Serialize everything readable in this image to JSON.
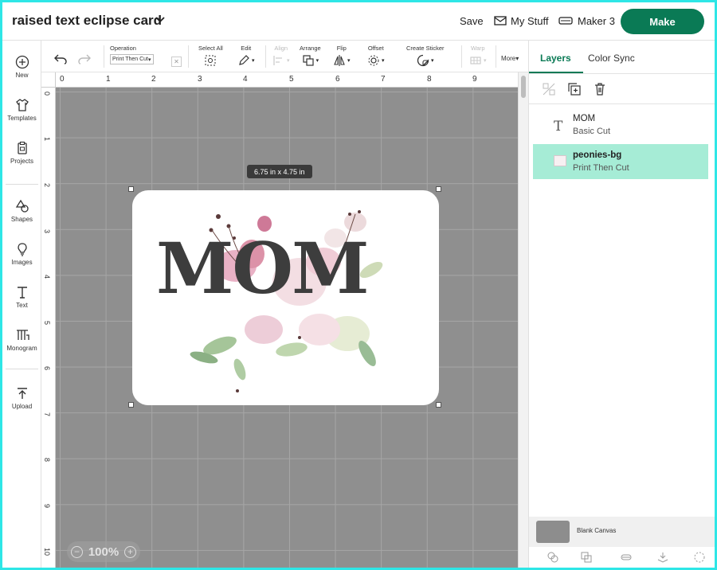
{
  "app": {
    "project_title": "raised text eclipse card",
    "save_label": "Save",
    "mystuff_label": "My Stuff",
    "machine_label": "Maker 3",
    "make_label": "Make",
    "accent_color": "#0a7a55",
    "frame_color": "#2ee6e6"
  },
  "sidebar": {
    "items": [
      {
        "label": "New",
        "icon": "plus-circle-icon"
      },
      {
        "label": "Templates",
        "icon": "shirt-icon"
      },
      {
        "label": "Projects",
        "icon": "clipboard-icon"
      },
      {
        "label": "Shapes",
        "icon": "shapes-icon"
      },
      {
        "label": "Images",
        "icon": "lightbulb-icon"
      },
      {
        "label": "Text",
        "icon": "text-icon"
      },
      {
        "label": "Monogram",
        "icon": "monogram-icon"
      },
      {
        "label": "Upload",
        "icon": "upload-icon"
      }
    ]
  },
  "toolbar": {
    "operation_label": "Operation",
    "operation_value": "Print Then Cut",
    "select_all_label": "Select All",
    "edit_label": "Edit",
    "align_label": "Align",
    "arrange_label": "Arrange",
    "flip_label": "Flip",
    "offset_label": "Offset",
    "create_sticker_label": "Create Sticker",
    "warp_label": "Warp",
    "more_label": "More"
  },
  "rulers": {
    "top": [
      "0",
      "1",
      "2",
      "3",
      "4",
      "5",
      "6",
      "7",
      "8",
      "9"
    ],
    "left": [
      "0",
      "1",
      "2",
      "3",
      "4",
      "5",
      "6",
      "7",
      "8",
      "9",
      "10"
    ]
  },
  "canvas": {
    "dimension_label": "6.75  in x 4.75  in",
    "card_text": "MOM",
    "zoom_value": "100%",
    "zoom_minus": "−",
    "zoom_plus": "+"
  },
  "layers_panel": {
    "tabs": [
      "Layers",
      "Color Sync"
    ],
    "layers": [
      {
        "name": "MOM",
        "subtitle": "Basic Cut",
        "icon": "text-icon",
        "selected": false
      },
      {
        "name": "peonies-bg",
        "subtitle": "Print Then Cut",
        "icon": "image-thumbnail-icon",
        "selected": true
      }
    ],
    "blank_canvas_label": "Blank Canvas"
  }
}
